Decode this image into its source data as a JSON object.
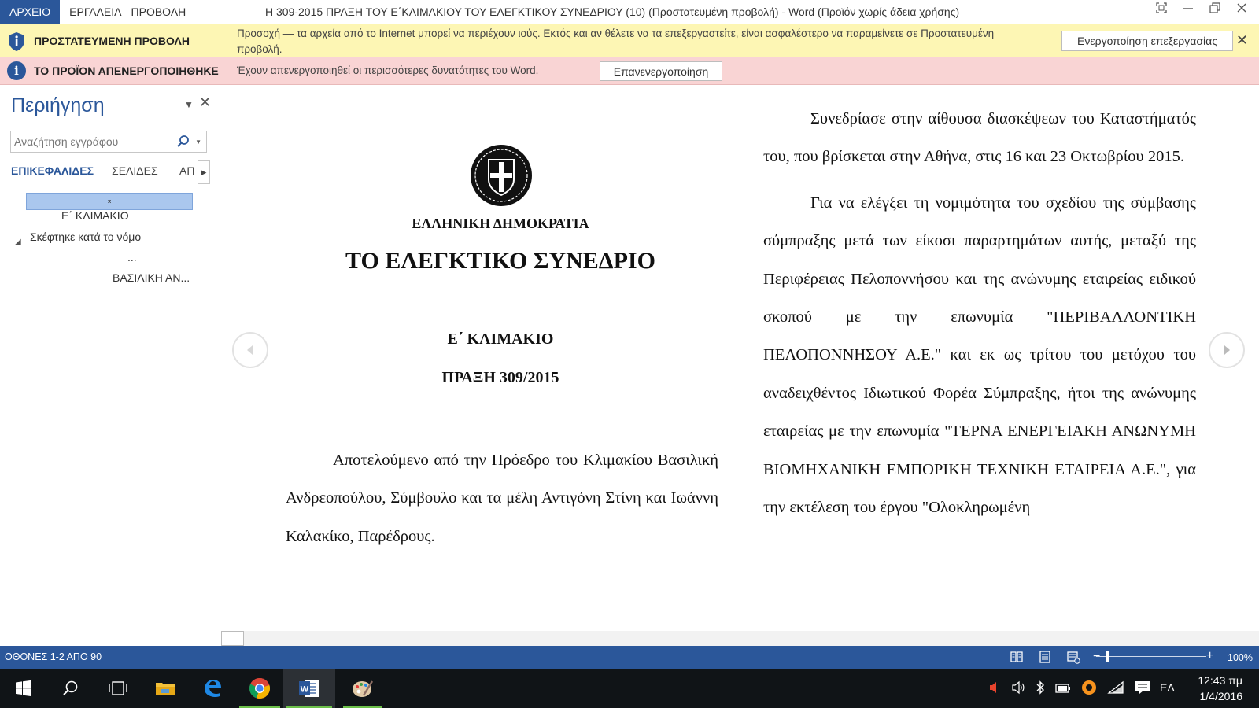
{
  "titlebar": {
    "file_menu": "ΑΡΧΕΙΟ",
    "menu": [
      "ΕΡΓΑΛΕΙΑ",
      "ΠΡΟΒΟΛΗ"
    ],
    "doc_title": "Η 309-2015 ΠΡΑΞΗ ΤΟΥ Ε΄ΚΛΙΜΑΚΙΟΥ  ΤΟΥ ΕΛΕΓΚΤΙΚΟΥ ΣΥΝΕΔΡΙΟΥ (10) (Προστατευμένη προβολή) - Word (Προϊόν χωρίς άδεια χρήσης)"
  },
  "protected_bar": {
    "title": "ΠΡΟΣΤΑΤΕΥΜΕΝΗ ΠΡΟΒΟΛΗ",
    "message": "Προσοχή — τα αρχεία από το Internet μπορεί να περιέχουν ιούς. Εκτός και αν θέλετε να τα επεξεργαστείτε, είναι ασφαλέστερο να παραμείνετε σε Προστατευμένη προβολή.",
    "button": "Ενεργοποίηση επεξεργασίας",
    "color": "#fdf6b4"
  },
  "deactivated_bar": {
    "title": "ΤΟ ΠΡΟΪΟΝ ΑΠΕΝΕΡΓΟΠΟΙΗΘΗΚΕ",
    "message": "Έχουν απενεργοποιηθεί οι περισσότερες δυνατότητες του Word.",
    "button": "Επανενεργοποίηση",
    "color": "#f9d4d4"
  },
  "nav": {
    "title": "Περιήγηση",
    "search_placeholder": "Αναζήτηση εγγράφου",
    "tabs": [
      "ΕΠΙΚΕΦΑΛΙΔΕΣ",
      "ΣΕΛΙΔΕΣ",
      "ΑΠΟΤΕΛΕΣΜΑΤΑ"
    ],
    "tab_clipped": "ΑΠ",
    "headings": [
      "Ε΄ ΚΛΙΜΑΚΙΟ",
      "Σκέφτηκε κατά το νόμο",
      "...",
      "ΒΑΣΙΛΙΚΗ ΑΝ..."
    ]
  },
  "document": {
    "republic": "ΕΛΛΗΝΙΚΗ ΔΗΜΟΚΡΑΤΙΑ",
    "court": "ΤΟ ΕΛΕΓΚΤΙΚΟ ΣΥΝΕΔΡΙΟ",
    "chamber": "Ε΄ ΚΛΙΜΑΚΙΟ",
    "act": "ΠΡΑΞΗ 309/2015",
    "left_paragraph": "Αποτελούμενο από την Πρόεδρο του Κλιμακίου Βασιλική Ανδρεοπούλου, Σύμβουλο και τα μέλη Αντιγόνη Στίνη και Ιωάννη Καλακίκο, Παρέδρους.",
    "right_paragraph_1": "Συνεδρίασε στην αίθουσα διασκέψεων του Καταστήματός του, που βρίσκεται στην Αθήνα, στις 16 και 23 Οκτωβρίου 2015.",
    "right_paragraph_2": "Για να ελέγξει τη νομιμότητα του σχεδίου της σύμβασης σύμπραξης μετά των είκοσι παραρτημάτων αυτής, μεταξύ της Περιφέρειας Πελοποννήσου και της ανώνυμης εταιρείας ειδικού σκοπού με την επωνυμία \"ΠΕΡΙΒΑΛΛΟΝΤΙΚΗ ΠΕΛΟΠΟΝΝΗΣΟΥ Α.Ε.\" και εκ ως τρίτου του μετόχου του αναδειχθέντος Ιδιωτικού Φορέα Σύμπραξης, ήτοι της ανώνυμης εταιρείας με την επωνυμία \"ΤΕΡΝΑ ΕΝΕΡΓΕΙΑΚΗ ΑΝΩΝΥΜΗ ΒΙΟΜΗΧΑΝΙΚΗ ΕΜΠΟΡΙΚΗ ΤΕΧΝΙΚΗ ΕΤΑΙΡΕΙΑ Α.Ε.\", για την εκτέλεση του έργου \"Ολοκληρωμένη"
  },
  "status": {
    "screens": "ΟΘΟΝΕΣ 1-2 ΑΠΟ 90",
    "zoom": "100%",
    "zoom_fraction": 0.1
  },
  "taskbar": {
    "icons": [
      "windows-start-icon",
      "search-icon",
      "task-view-icon",
      "file-explorer-icon",
      "edge-icon",
      "chrome-icon",
      "word-icon",
      "paint-icon"
    ],
    "lang": "ΕΛ",
    "time": "12:43 πμ",
    "date": "1/4/2016"
  },
  "colors": {
    "word_blue": "#2b579a",
    "taskbar": "#101417"
  }
}
